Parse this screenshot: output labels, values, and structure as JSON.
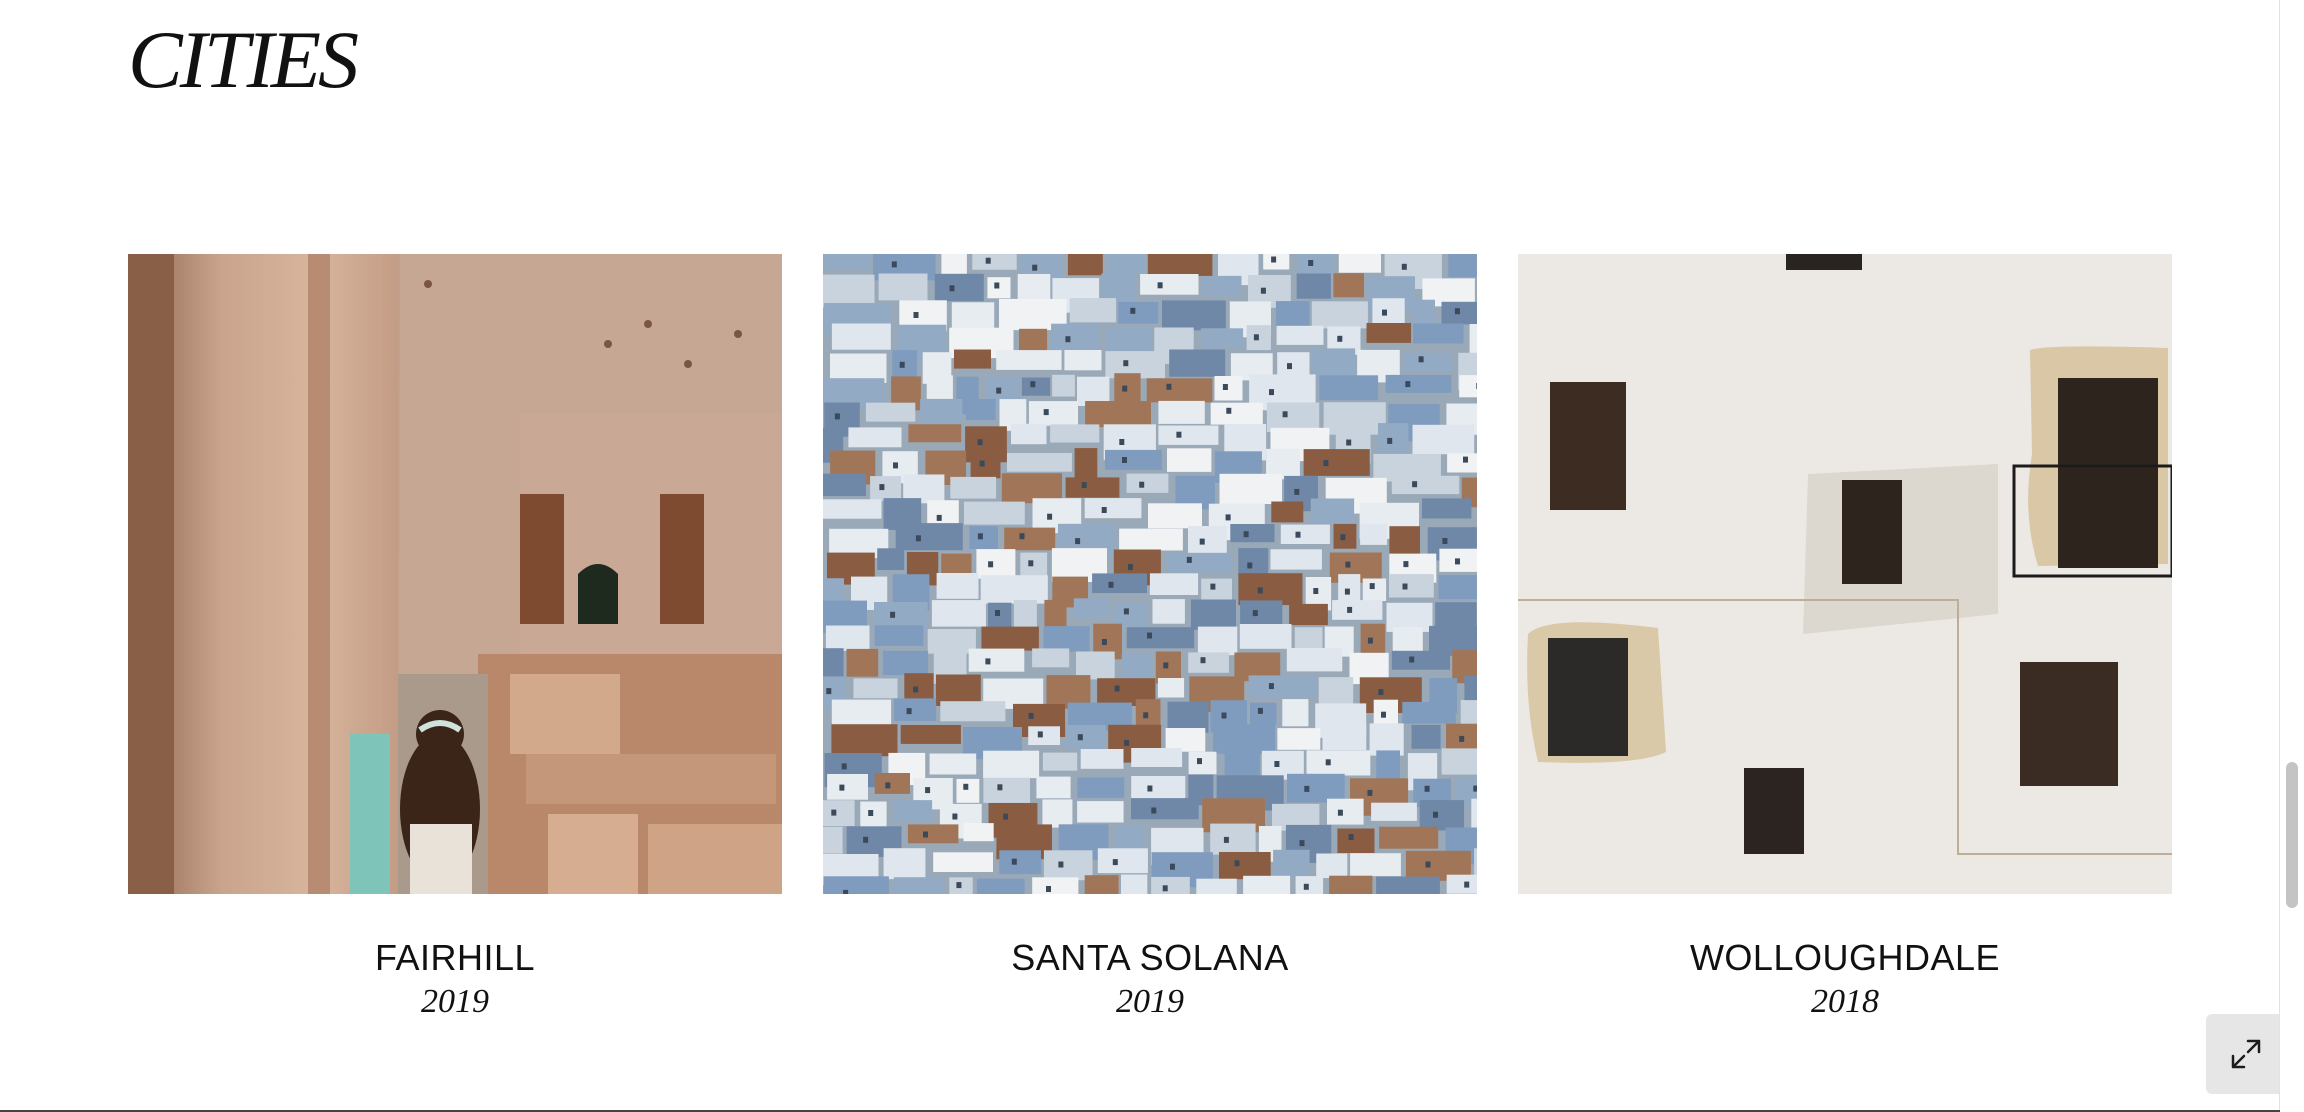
{
  "section": {
    "title": "CITIES"
  },
  "gallery": {
    "items": [
      {
        "name": "FAIRHILL",
        "year": "2019",
        "image": "desert-ruins-girl-walking-photo"
      },
      {
        "name": "SANTA SOLANA",
        "year": "2019",
        "image": "blue-hillside-town-aerial-photo"
      },
      {
        "name": "WOLLOUGHDALE",
        "year": "2018",
        "image": "white-wall-windows-photo"
      }
    ]
  },
  "controls": {
    "expand_icon": "expand-arrows-icon"
  },
  "colors": {
    "text": "#111111",
    "background": "#ffffff",
    "button_bg": "#e6e6e6"
  }
}
